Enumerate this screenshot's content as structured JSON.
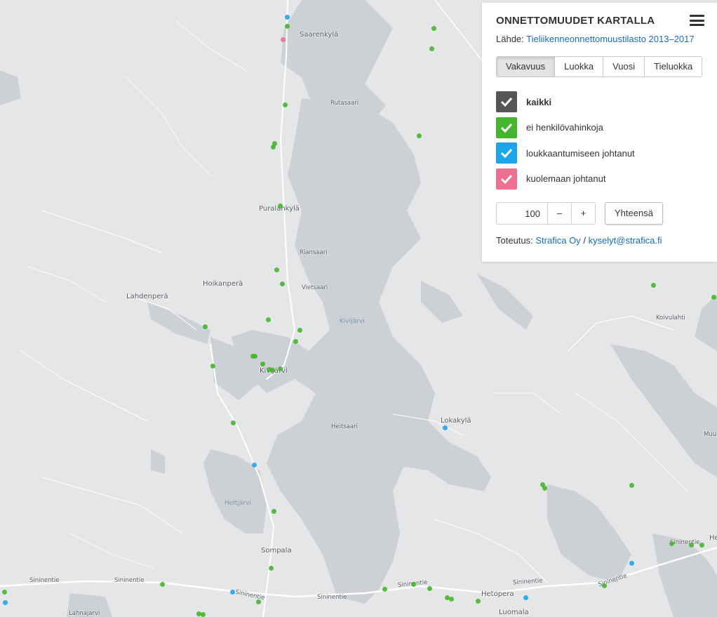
{
  "panel": {
    "title": "ONNETTOMUUDET KARTALLA",
    "source_label": "Lähde:",
    "source_link": "Tieliikenneonnettomuustilasto 2013–2017",
    "tabs": [
      "Vakavuus",
      "Luokka",
      "Vuosi",
      "Tieluokka"
    ],
    "active_tab": "Vakavuus",
    "legend": [
      {
        "label": "kaikki",
        "color": "#555555",
        "checked": true,
        "bold": true
      },
      {
        "label": "ei henkilövahinkoja",
        "color": "#44b52d",
        "checked": true,
        "bold": false
      },
      {
        "label": "loukkaantumiseen johtanut",
        "color": "#1ca6ea",
        "checked": true,
        "bold": false
      },
      {
        "label": "kuolemaan johtanut",
        "color": "#ee6f92",
        "checked": true,
        "bold": false
      }
    ],
    "count_value": "100",
    "minus_label": "–",
    "plus_label": "+",
    "total_button": "Yhteensä",
    "credit_label": "Toteutus:",
    "credit_company": "Strafica Oy",
    "credit_sep": "/",
    "credit_email": "kyselyt@strafica.fi",
    "menu_icon": "hamburger-menu-icon"
  },
  "map": {
    "colors": {
      "land": "#e4e6e8",
      "water": "#cdd1d6",
      "road": "#ffffff"
    },
    "places": [
      "Saarenkylä",
      "Rutasaari",
      "Puralankylä",
      "Riansaari",
      "Hoikanperä",
      "Lahdenperä",
      "Vietsaari",
      "Kivijärvi",
      "Kivijärvi",
      "Koivulahti",
      "Heitsaari",
      "Lokakylä",
      "Heitjärvi",
      "Sompala",
      "Sininentie",
      "Sininentie",
      "Sininentie",
      "Sininentie",
      "Sininentie",
      "Sininentie",
      "Sininentie",
      "Hetopera",
      "Luomala",
      "Lahnajarvi",
      "Muu",
      "He"
    ],
    "accident_dots": {
      "green": 44,
      "blue": 7,
      "pink": 1
    }
  }
}
